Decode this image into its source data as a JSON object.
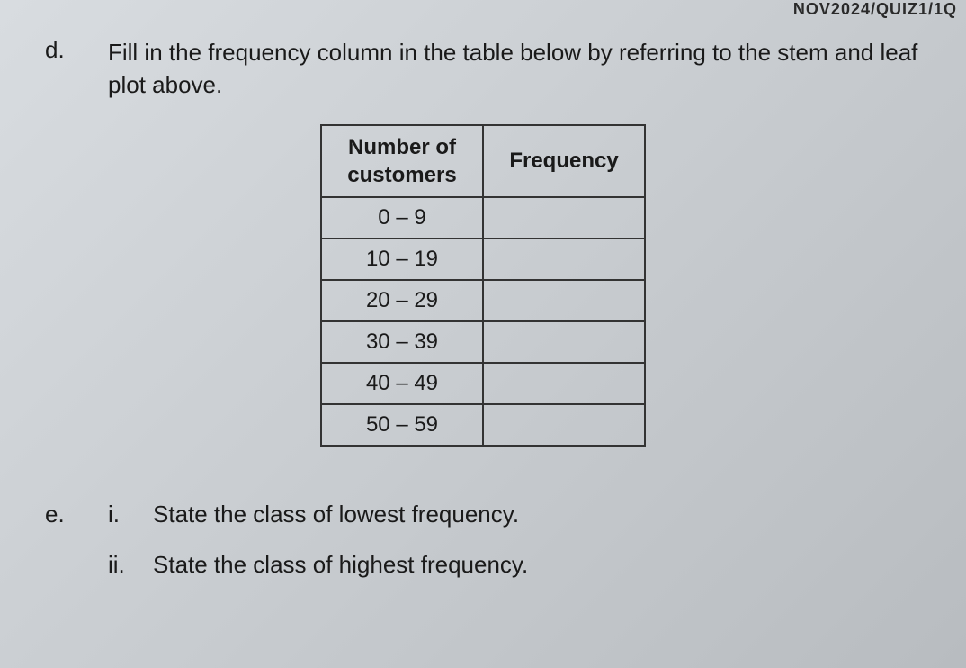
{
  "header_fragment": "NOV2024/QUIZ1/1Q",
  "question_d": {
    "label": "d.",
    "text": "Fill in the frequency column in the table below by referring to the stem and leaf plot above."
  },
  "table": {
    "header": {
      "col1_line1": "Number of",
      "col1_line2": "customers",
      "col2": "Frequency"
    },
    "rows": [
      {
        "range": "0 – 9",
        "frequency": ""
      },
      {
        "range": "10 – 19",
        "frequency": ""
      },
      {
        "range": "20 – 29",
        "frequency": ""
      },
      {
        "range": "30 – 39",
        "frequency": ""
      },
      {
        "range": "40 – 49",
        "frequency": ""
      },
      {
        "range": "50 – 59",
        "frequency": ""
      }
    ]
  },
  "question_e": {
    "label": "e.",
    "items": [
      {
        "label": "i.",
        "text": "State the class of lowest frequency."
      },
      {
        "label": "ii.",
        "text": "State the class of highest frequency."
      }
    ]
  }
}
